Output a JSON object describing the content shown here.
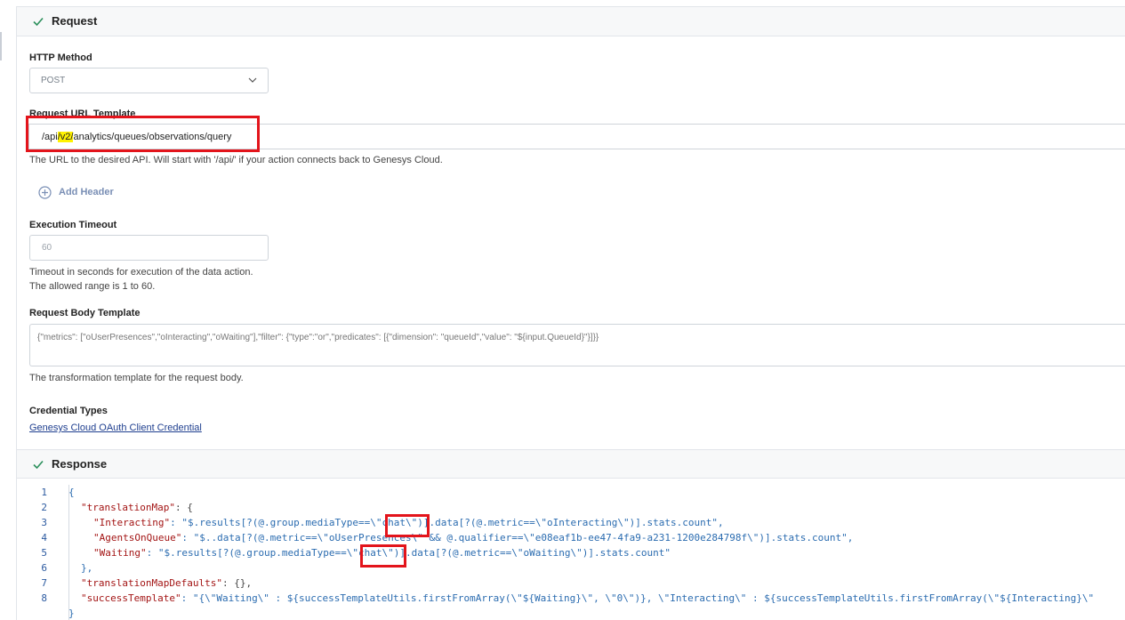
{
  "request": {
    "title": "Request",
    "http_method": {
      "label": "HTTP Method",
      "value": "POST"
    },
    "url": {
      "label": "Request URL Template",
      "value_prefix": "/api",
      "value_highlight": "/v2/",
      "value_suffix": "analytics/queues/observations/query",
      "help": "The URL to the desired API. Will start with '/api/' if your action connects back to Genesys Cloud."
    },
    "add_header_label": "Add Header",
    "timeout": {
      "label": "Execution Timeout",
      "value": "60",
      "help_1": "Timeout in seconds for execution of the data action.",
      "help_2": "The allowed range is 1 to 60."
    },
    "body_template": {
      "label": "Request Body Template",
      "value": "{\"metrics\": [\"oUserPresences\",\"oInteracting\",\"oWaiting\"],\"filter\": {\"type\":\"or\",\"predicates\": [{\"dimension\": \"queueId\",\"value\": \"${input.QueueId}\"}]}}",
      "help": "The transformation template for the request body."
    },
    "credential": {
      "label": "Credential Types",
      "link": "Genesys Cloud OAuth Client Credential"
    }
  },
  "response": {
    "title": "Response",
    "line_numbers": [
      "1",
      "2",
      "3",
      "4",
      "5",
      "6",
      "7",
      "8"
    ],
    "code": {
      "l1": "{",
      "l2_key": "\"translationMap\"",
      "l2_rest": ": {",
      "l3_key": "\"Interacting\"",
      "l3_a": ": \"$.results[?(@.group.mediaType==\\\"",
      "l3_b": "chat\\\"",
      "l3_c": ")].data[?(@.metric==\\\"oInteracting\\\")].stats.count\",",
      "l4_key": "\"AgentsOnQueue\"",
      "l4_rest": ": \"$..data[?(@.metric==\\\"oUserPresences\\\" && @.qualifier==\\\"e08eaf1b-ee47-4fa9-a231-1200e284798f\\\")].stats.count\",",
      "l5_key": "\"Waiting\"",
      "l5_a": ": \"$.results[?(@.group.mediaType==\\\"",
      "l5_b": "chat\\\"",
      "l5_c": ")].data[?(@.metric==\\\"oWaiting\\\")].stats.count\"",
      "l6": "},",
      "l7_key": "\"translationMapDefaults\"",
      "l7_rest": ": {},",
      "l8_key": "\"successTemplate\"",
      "l8_rest": ": \"{\\\"Waiting\\\" : ${successTemplateUtils.firstFromArray(\\\"${Waiting}\\\", \\\"0\\\")}, \\\"Interacting\\\" : ${successTemplateUtils.firstFromArray(\\\"${Interacting}\\\"",
      "l9": "}"
    }
  },
  "colors": {
    "accent": "#e3141b",
    "highlight": "#fff200",
    "link": "#1f3f8f",
    "check": "#2a8f5b"
  }
}
